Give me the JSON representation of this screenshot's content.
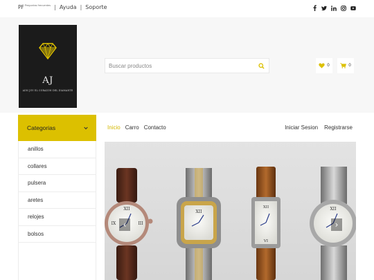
{
  "topbar": {
    "brand": "PF",
    "brand_sub": "Preguntas frecuentes",
    "links": [
      "Ayuda",
      "Soporte"
    ],
    "social": [
      "facebook-icon",
      "twitter-icon",
      "linkedin-icon",
      "instagram-icon",
      "youtube-icon"
    ]
  },
  "logo": {
    "monogram": "AJ",
    "tagline": "ADN JOY EL CORAZON DEL DIAMANTE"
  },
  "search": {
    "placeholder": "Buscar productos",
    "icon": "search-icon"
  },
  "header_actions": {
    "wishlist_count": "0",
    "cart_count": "0"
  },
  "categories": {
    "title": "Categorias",
    "items": [
      "anillos",
      "collares",
      "pulsera",
      "aretes",
      "relojes",
      "bolsos"
    ]
  },
  "nav": {
    "links": [
      "Inicio",
      "Carro",
      "Contacto"
    ],
    "account": [
      "Iniciar Sesion",
      "Registrarse"
    ]
  },
  "banner": {
    "prev_icon": "chevron-left-icon",
    "next_icon": "chevron-right-icon"
  },
  "colors": {
    "accent": "#dcc000",
    "accent_text": "#d4b800",
    "header_bg": "#f7f7f7",
    "logo_bg": "#1b1b1b"
  }
}
